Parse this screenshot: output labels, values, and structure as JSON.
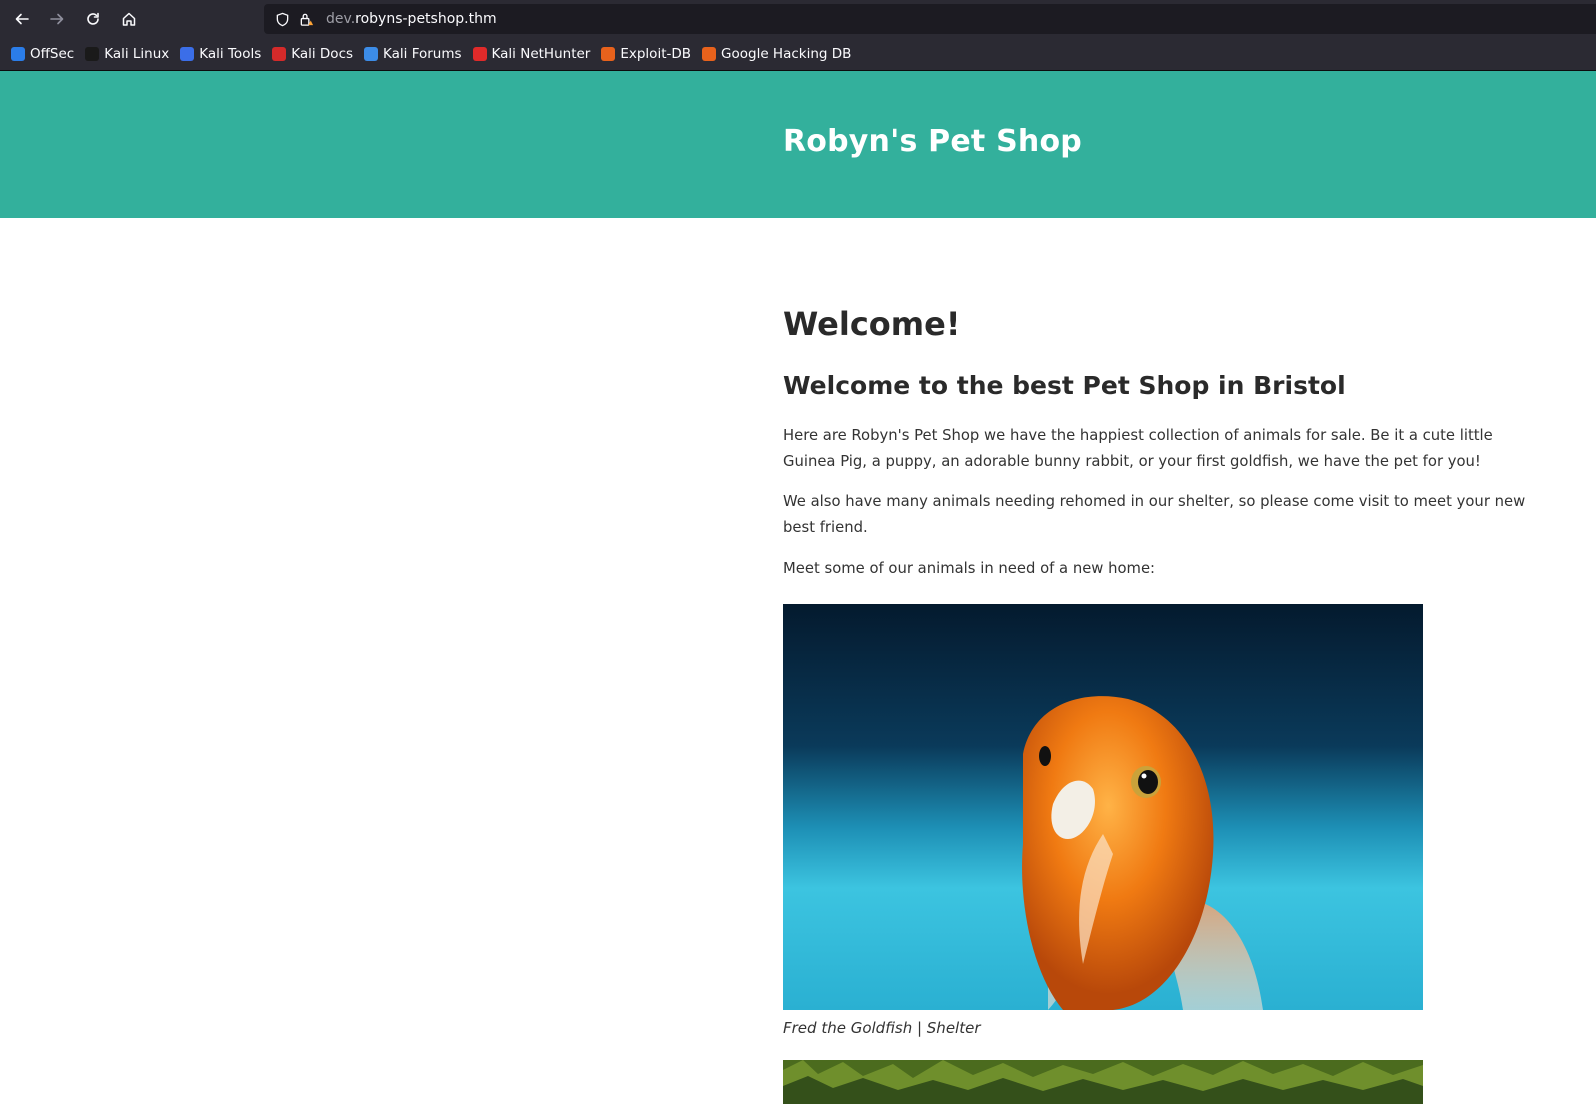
{
  "browser": {
    "url_prefix": "dev.",
    "url_domain": "robyns-petshop.thm",
    "bookmarks": [
      {
        "label": "OffSec",
        "color": "#2b7de9"
      },
      {
        "label": "Kali Linux",
        "color": "#1a1a1a"
      },
      {
        "label": "Kali Tools",
        "color": "#3b6ee8"
      },
      {
        "label": "Kali Docs",
        "color": "#d42a2a"
      },
      {
        "label": "Kali Forums",
        "color": "#3c8ce7"
      },
      {
        "label": "Kali NetHunter",
        "color": "#e02a2a"
      },
      {
        "label": "Exploit-DB",
        "color": "#e8621c"
      },
      {
        "label": "Google Hacking DB",
        "color": "#e8621c"
      }
    ]
  },
  "site": {
    "title": "Robyn's Pet Shop",
    "header_color": "#33b09c"
  },
  "main": {
    "heading": "Welcome!",
    "subheading": "Welcome to the best Pet Shop in Bristol",
    "paragraph1": "Here are Robyn's Pet Shop we have the happiest collection of animals for sale. Be it a cute little Guinea Pig, a puppy, an adorable bunny rabbit, or your first goldfish, we have the pet for you!",
    "paragraph2": "We also have many animals needing rehomed in our shelter, so please come visit to meet your new best friend.",
    "paragraph3": "Meet some of our animals in need of a new home:",
    "caption1": "Fred the Goldfish | Shelter"
  }
}
